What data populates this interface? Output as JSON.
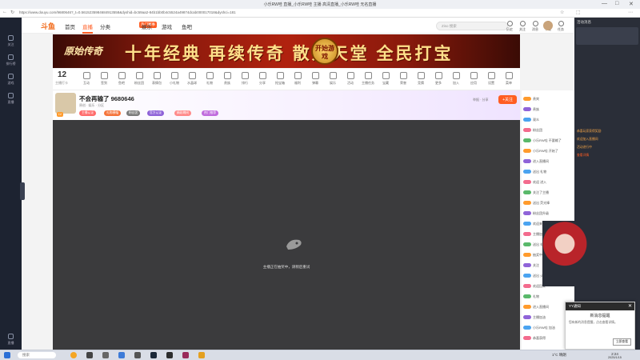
{
  "browser": {
    "title": "小乐RW哇 直播_小乐RW哇 主播 高清直播_小乐RW哇 无名直播",
    "url": "https://www.douyu.com/9680646?_t=0.5615235984684913558&dyshid=bc59aa2-84b1bb0b4c5524a49874dcab000017018&dyshci=181",
    "win_controls": [
      "—",
      "□",
      "✕"
    ]
  },
  "rail": {
    "items": [
      "关注",
      "排行榜",
      "游戏",
      "直播",
      "直播"
    ]
  },
  "header": {
    "logo": "斗鱼",
    "nav": [
      "首页",
      "直播",
      "分类",
      "热门赛事",
      "娱乐",
      "游戏",
      "鱼吧"
    ],
    "hot_badge": "热门赛事",
    "search_placeholder": "Ziso 搜索",
    "icons": [
      {
        "name": "history-icon",
        "label": "历史"
      },
      {
        "name": "follow-icon",
        "label": "关注"
      },
      {
        "name": "message-icon",
        "label": "消息"
      },
      {
        "name": "download-icon",
        "label": "下载"
      },
      {
        "name": "task-icon",
        "label": "任务"
      },
      {
        "name": "open-live-icon",
        "label": "开播"
      }
    ]
  },
  "banner": {
    "game": "原始传奇",
    "slogan": "十年经典 再续传奇 散人天堂 全民打宝",
    "seal": "开始游戏"
  },
  "toolbar": {
    "count": "12",
    "count_label": "主播打卡",
    "items": [
      "互动",
      "签到",
      "鱼吧",
      "粉丝团",
      "表情包",
      "小礼物",
      "水晶球",
      "礼物",
      "贵族",
      "排行",
      "分享",
      "抢宝箱",
      "福利",
      "弹幕",
      "娱乐",
      "活动",
      "主播任务",
      "宝藏",
      "荣誉",
      "竞猜",
      "更多",
      "加入",
      "应用",
      "设置",
      "菜单"
    ]
  },
  "room": {
    "title": "不会再输了 9680646",
    "level_badge": "LV",
    "meta": "原创 · 娱乐 · 分区",
    "tags": [
      "主播认证",
      "礼物横幅",
      "粉丝团",
      "官方认证",
      "精彩瞬间",
      "热门推荐"
    ],
    "follow": "+关注",
    "right_text": "举报 · 分享"
  },
  "video": {
    "loading_text": "主播正在抽奖中，请稍后重试"
  },
  "chat": {
    "rows": [
      "贵宾",
      "贵族",
      "观众",
      "粉丝团",
      "小乐RW哇 不要输了",
      "小乐RW哇 开始了",
      "进入直播间",
      "送出 礼物",
      "欢迎 进入",
      "关注了主播",
      "送出 荧光棒",
      "粉丝团升级",
      "欢迎来到直播间",
      "主播加油",
      "送出 礼物",
      "抽奖中",
      "关注",
      "送出 火箭",
      "欢迎回来",
      "礼物",
      "进入直播间",
      "主播加油",
      "小乐RW哇 加油",
      "恭喜获得"
    ]
  },
  "side": {
    "head": "活动消息",
    "lines": [
      "恭喜玩家获得奖励",
      "欢迎加入直播间",
      "活动进行中",
      "查看详情"
    ]
  },
  "popup": {
    "header": "YY通知",
    "title": "新消息提醒",
    "body": "您有新的消息提醒，点击查看详情。",
    "button": "立即查看"
  },
  "taskbar": {
    "search": "搜索",
    "weather": "1°C 晴朗",
    "time": "2:24",
    "date": "2025/1/15"
  }
}
